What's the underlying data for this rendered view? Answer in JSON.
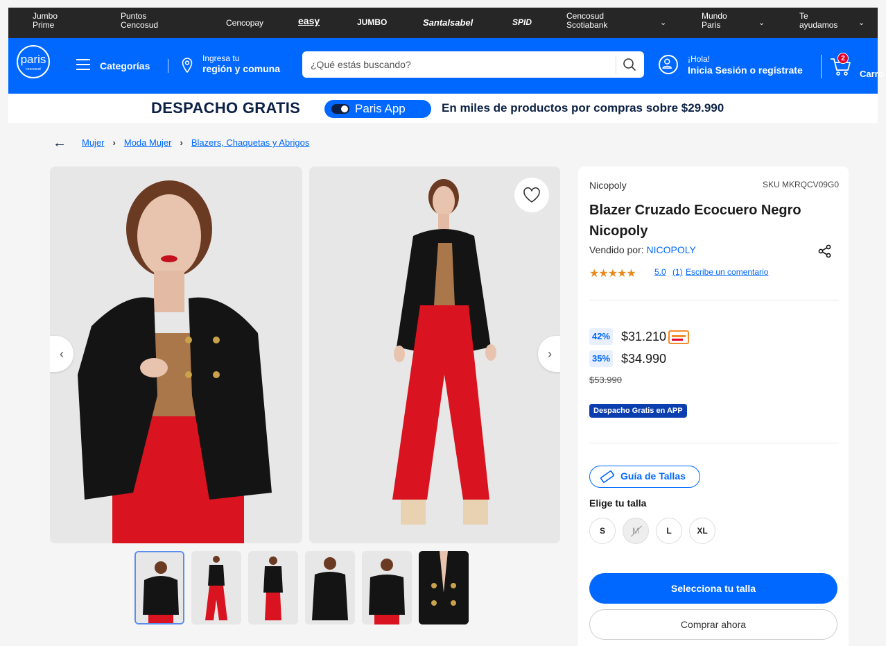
{
  "topbar": {
    "items": [
      "Jumbo\nPrime",
      "Puntos\nCencosud",
      "Cencopay",
      "easy",
      "JUMBO",
      "Santa Isabel",
      "SPID",
      "Cencosud\nScotiabank",
      "Mundo\nParis",
      "Te\nayudamos"
    ],
    "item_labels": {
      "jumbo_prime_1": "Jumbo",
      "jumbo_prime_2": "Prime",
      "puntos_1": "Puntos",
      "puntos_2": "Cencosud",
      "cencopay": "Cencopay",
      "easy": "easy",
      "jumbo": "JUMBO",
      "santaisabel": "SantaIsabel",
      "spid": "SPID",
      "scotia_1": "Cencosud",
      "scotia_2": "Scotiabank",
      "mundo_1": "Mundo",
      "mundo_2": "Paris",
      "ayuda_1": "Te",
      "ayuda_2": "ayudamos"
    }
  },
  "header": {
    "logo_word": "paris",
    "logo_sub": "cencosud",
    "categories": "Categorías",
    "region_line1": "Ingresa tu",
    "region_line2": "región y comuna",
    "search_placeholder": "¿Qué estás buscando?",
    "greeting": "¡Hola!",
    "login": "Inicia Sesión o regístrate",
    "cart_count": "2",
    "cart_label": "Carro",
    "brand_color": "#0068ff"
  },
  "promo": {
    "headline": "DESPACHO GRATIS",
    "pill": "Paris App",
    "rest_text": "En miles de productos por compras sobre ",
    "rest_amount": "$29.990"
  },
  "breadcrumb": [
    "Mujer",
    "Moda Mujer",
    "Blazers, Chaquetas y Abrigos"
  ],
  "product": {
    "brand": "Nicopoly",
    "sku": "SKU MKRQCV09G0",
    "title": "Blazer Cruzado Ecocuero Negro Nicopoly",
    "sold_by_label": "Vendido por: ",
    "sold_by": "NICOPOLY",
    "stars": "★★★★★",
    "rating": "5.0",
    "rating_count": "(1)",
    "comment_link": "Escribe un comentario",
    "prices": [
      {
        "discount": "42%",
        "price": "$31.210"
      },
      {
        "discount": "35%",
        "price": "$34.990"
      }
    ],
    "original_price": "$53.990",
    "shipping_badge": "Despacho Gratis en APP",
    "size_guide": "Guía de Tallas",
    "choose_size": "Elige tu talla",
    "sizes": [
      {
        "label": "S",
        "available": true
      },
      {
        "label": "M",
        "available": false
      },
      {
        "label": "L",
        "available": true
      },
      {
        "label": "XL",
        "available": true
      }
    ],
    "primary_button": "Selecciona tu talla",
    "secondary_button": "Comprar ahora",
    "thumbnail_count": 6
  }
}
